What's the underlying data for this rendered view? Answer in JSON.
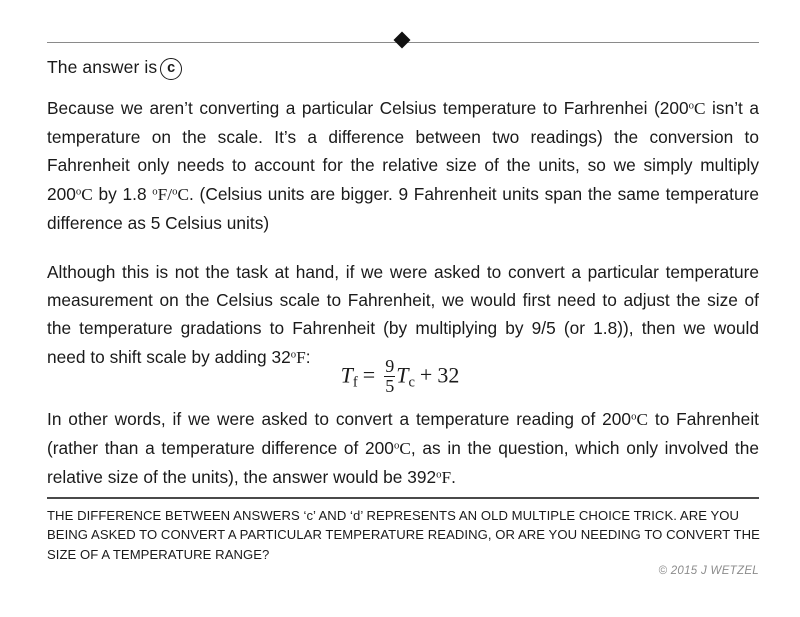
{
  "document": {
    "answer_prefix": "The answer is",
    "answer_choice": "c",
    "paragraphs": [
      {
        "id": "paragraph-reason",
        "segments": [
          {
            "type": "text",
            "value": "Because we aren’t converting a particular Celsius temperature to Farhrenhei (200"
          },
          {
            "type": "unit",
            "value": "°C"
          },
          {
            "type": "text",
            "value": " isn’t a temperature on the scale.  It’s a difference between two readings) the conversion to Fahrenheit only needs to account for the relative size of the units, so we simply multiply 200"
          },
          {
            "type": "unit",
            "value": "°C"
          },
          {
            "type": "text",
            "value": " by 1.8 "
          },
          {
            "type": "unit",
            "value": "°F/°C"
          },
          {
            "type": "text",
            "value": ".  (Celsius units are bigger.  9 Fahrenheit units span the same temperature difference as 5 Celsius units)"
          }
        ]
      },
      {
        "id": "paragraph-although",
        "segments": [
          {
            "type": "text",
            "value": "Although this is not the task at hand, if we were asked to convert a particular temperature measurement on the Celsius scale to Fahrenheit, we would first need to adjust the size of the temperature gradations to Fahrenheit (by multiplying by 9/5 (or 1.8)), then we would need to shift scale by adding 32"
          },
          {
            "type": "unit",
            "value": "°F"
          },
          {
            "type": "text",
            "value": ":"
          }
        ]
      }
    ],
    "formula": {
      "left_symbol": "T",
      "left_subscript": "f",
      "equals": "=",
      "numerator": "9",
      "denominator": "5",
      "right_symbol": "T",
      "right_subscript": "c",
      "plus": "+",
      "constant": "32"
    },
    "paragraph_final": {
      "id": "paragraph-in-other-words",
      "segments": [
        {
          "type": "text",
          "value": "In other words, if we were asked to convert a temperature reading of 200"
        },
        {
          "type": "unit",
          "value": "°C"
        },
        {
          "type": "text",
          "value": " to Fahrenheit (rather than a temperature difference of 200"
        },
        {
          "type": "unit",
          "value": "°C"
        },
        {
          "type": "text",
          "value": ", as in the question, which only involved the relative size of the units), the answer would be 392"
        },
        {
          "type": "unit",
          "value": "°F"
        },
        {
          "type": "text",
          "value": "."
        }
      ]
    },
    "footer_note": "THE DIFFERENCE BETWEEN ANSWERS ‘c’ AND ‘d’ REPRESENTS AN OLD MULTIPLE CHOICE TRICK.  ARE YOU BEING ASKED TO CONVERT A PARTICULAR TEMPERATURE READING, OR ARE YOU NEEDING TO CONVERT THE SIZE OF A TEMPERATURE RANGE?",
    "copyright": "© 2015 J WETZEL"
  },
  "colors": {
    "text": "#1a1a1a",
    "top_rule": "#8a8a8a",
    "footer_rule": "#4a4a4a",
    "copyright": "#8c8c8c",
    "background": "#ffffff"
  }
}
